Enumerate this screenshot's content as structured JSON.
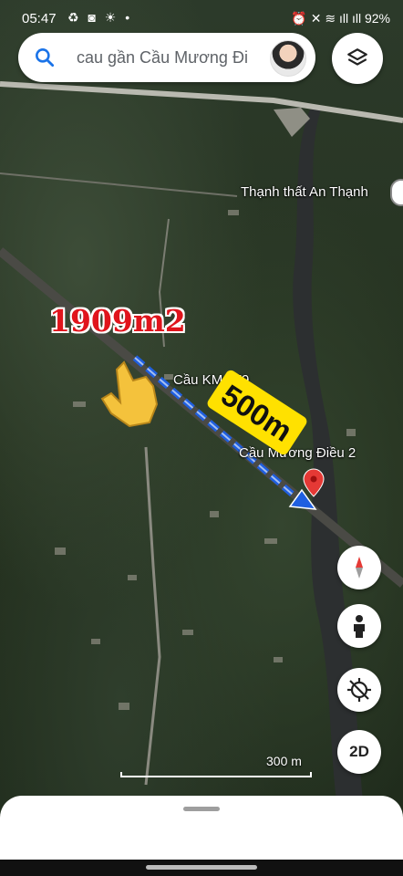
{
  "status_bar": {
    "time": "05:47",
    "left_icons": "♻ ◙ ☀ •",
    "right_text": "⏰ ✕ ≋ ıll ıll 92%"
  },
  "search": {
    "query": "cau gần Cầu Mương Đi"
  },
  "map": {
    "place_labels": {
      "temple": "Thạnh thất An Thạnh",
      "bridge_km": "Cầu KM 179",
      "bridge_muong_dieu": "Cầu Mương Điều 2"
    },
    "scale": "300 m"
  },
  "annotations": {
    "area": "1909m2",
    "distance": "500m"
  },
  "controls": {
    "view_2d": "2D"
  },
  "colors": {
    "annotation_red": "#e0141c",
    "badge_yellow": "#ffe100",
    "arrow_blue": "#1f5fe0",
    "pin_red": "#e53935"
  },
  "icons": [
    "search-icon",
    "layers-icon",
    "compass-icon",
    "pegman-icon",
    "location-off-icon",
    "pointing-hand-icon",
    "map-pin-icon"
  ]
}
